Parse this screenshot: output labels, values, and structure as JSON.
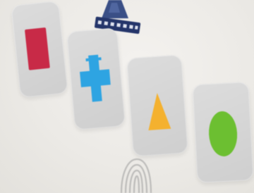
{
  "scene": {
    "background_color": "#ecebe7",
    "tile_color": "#d4d4d4"
  },
  "logo": {
    "icon": "film-projector-icon",
    "color": "#3a4f86"
  },
  "tiles": [
    {
      "shape": "square",
      "icon": "square-icon",
      "color": "#c82a47"
    },
    {
      "shape": "cross",
      "icon": "cross-icon",
      "color": "#2ea4e2"
    },
    {
      "shape": "triangle",
      "icon": "triangle-icon",
      "color": "#f4b12f"
    },
    {
      "shape": "circle",
      "icon": "circle-icon",
      "color": "#6cbf31"
    }
  ],
  "bottom": {
    "icon": "fingerprint-icon",
    "color": "#9a9a9a"
  }
}
